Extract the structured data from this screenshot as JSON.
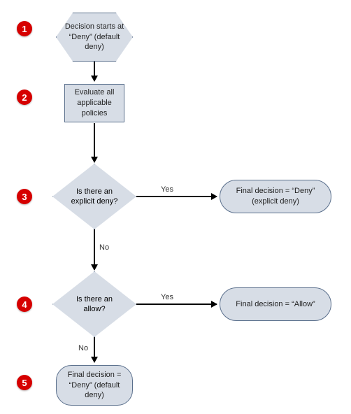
{
  "chart_data": {
    "type": "flowchart",
    "nodes": [
      {
        "id": "n1",
        "step": 1,
        "shape": "hexagon",
        "text": "Decision starts at \"Deny\" (default deny)"
      },
      {
        "id": "n2",
        "step": 2,
        "shape": "process",
        "text": "Evaluate all applicable policies"
      },
      {
        "id": "n3",
        "step": 3,
        "shape": "decision",
        "text": "Is there an explicit deny?"
      },
      {
        "id": "n4",
        "step": 4,
        "shape": "decision",
        "text": "Is there an allow?"
      },
      {
        "id": "t3",
        "shape": "terminator",
        "text": "Final decision = \"Deny\" (explicit deny)"
      },
      {
        "id": "t4",
        "shape": "terminator",
        "text": "Final decision = \"Allow\""
      },
      {
        "id": "n5",
        "step": 5,
        "shape": "terminator",
        "text": "Final decision = \"Deny\" (default deny)"
      }
    ],
    "edges": [
      {
        "from": "n1",
        "to": "n2",
        "label": ""
      },
      {
        "from": "n2",
        "to": "n3",
        "label": ""
      },
      {
        "from": "n3",
        "to": "t3",
        "label": "Yes"
      },
      {
        "from": "n3",
        "to": "n4",
        "label": "No"
      },
      {
        "from": "n4",
        "to": "t4",
        "label": "Yes"
      },
      {
        "from": "n4",
        "to": "n5",
        "label": "No"
      }
    ]
  },
  "nodes": {
    "n1": "Decision starts at “Deny” (default deny)",
    "n2": "Evaluate all applicable policies",
    "n3": "Is there an explicit deny?",
    "n4": "Is there an allow?",
    "t3": "Final decision = “Deny” (explicit deny)",
    "t4": "Final decision = “Allow”",
    "n5": "Final decision = “Deny” (default deny)"
  },
  "labels": {
    "yes": "Yes",
    "no": "No"
  },
  "badges": {
    "b1": "1",
    "b2": "2",
    "b3": "3",
    "b4": "4",
    "b5": "5"
  }
}
